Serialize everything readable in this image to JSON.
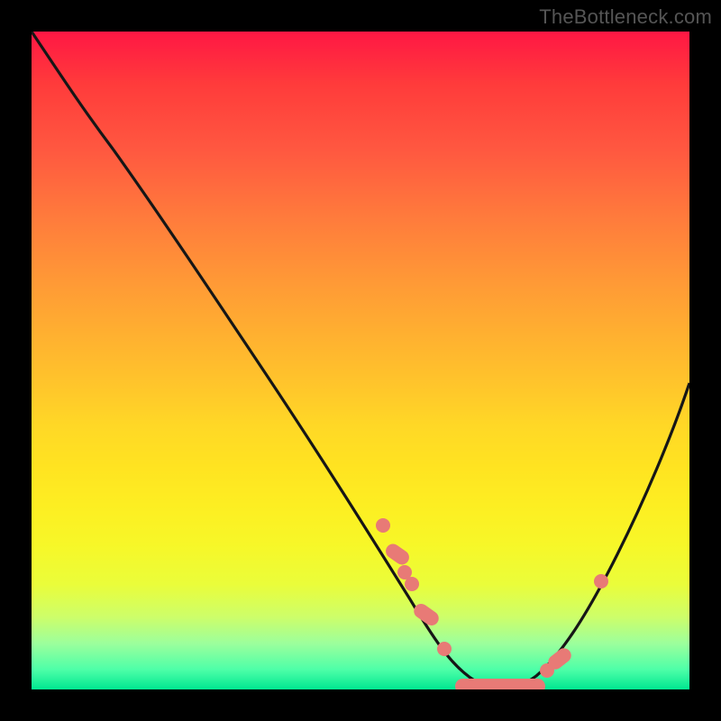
{
  "watermark": "TheBottleneck.com",
  "chart_data": {
    "type": "line",
    "title": "",
    "xlabel": "",
    "ylabel": "",
    "xlim": [
      0,
      100
    ],
    "ylim": [
      0,
      100
    ],
    "background_gradient": {
      "top": "#ff1744",
      "mid": "#ffe028",
      "bottom": "#00e690"
    },
    "series": [
      {
        "name": "curve",
        "x": [
          0,
          5,
          10,
          15,
          20,
          25,
          30,
          35,
          40,
          45,
          50,
          55,
          60,
          63,
          66,
          70,
          75,
          80,
          85,
          90,
          95,
          100
        ],
        "y": [
          100,
          96,
          91,
          84,
          77,
          70,
          63,
          55,
          47,
          39,
          30,
          21,
          12,
          6,
          2,
          0,
          1,
          6,
          15,
          25,
          36,
          47
        ]
      }
    ],
    "markers": [
      {
        "x": 53,
        "y": 25,
        "shape": "circle"
      },
      {
        "x": 55,
        "y": 21,
        "shape": "pill_short"
      },
      {
        "x": 56.5,
        "y": 18,
        "shape": "circle"
      },
      {
        "x": 57.5,
        "y": 16,
        "shape": "circle"
      },
      {
        "x": 60,
        "y": 12,
        "shape": "pill_short"
      },
      {
        "x": 63,
        "y": 6,
        "shape": "circle"
      },
      {
        "x": 70,
        "y": 0,
        "shape": "pill_long"
      },
      {
        "x": 77,
        "y": 2,
        "shape": "circle"
      },
      {
        "x": 79,
        "y": 5,
        "shape": "pill_short"
      },
      {
        "x": 86,
        "y": 17,
        "shape": "circle"
      }
    ]
  }
}
